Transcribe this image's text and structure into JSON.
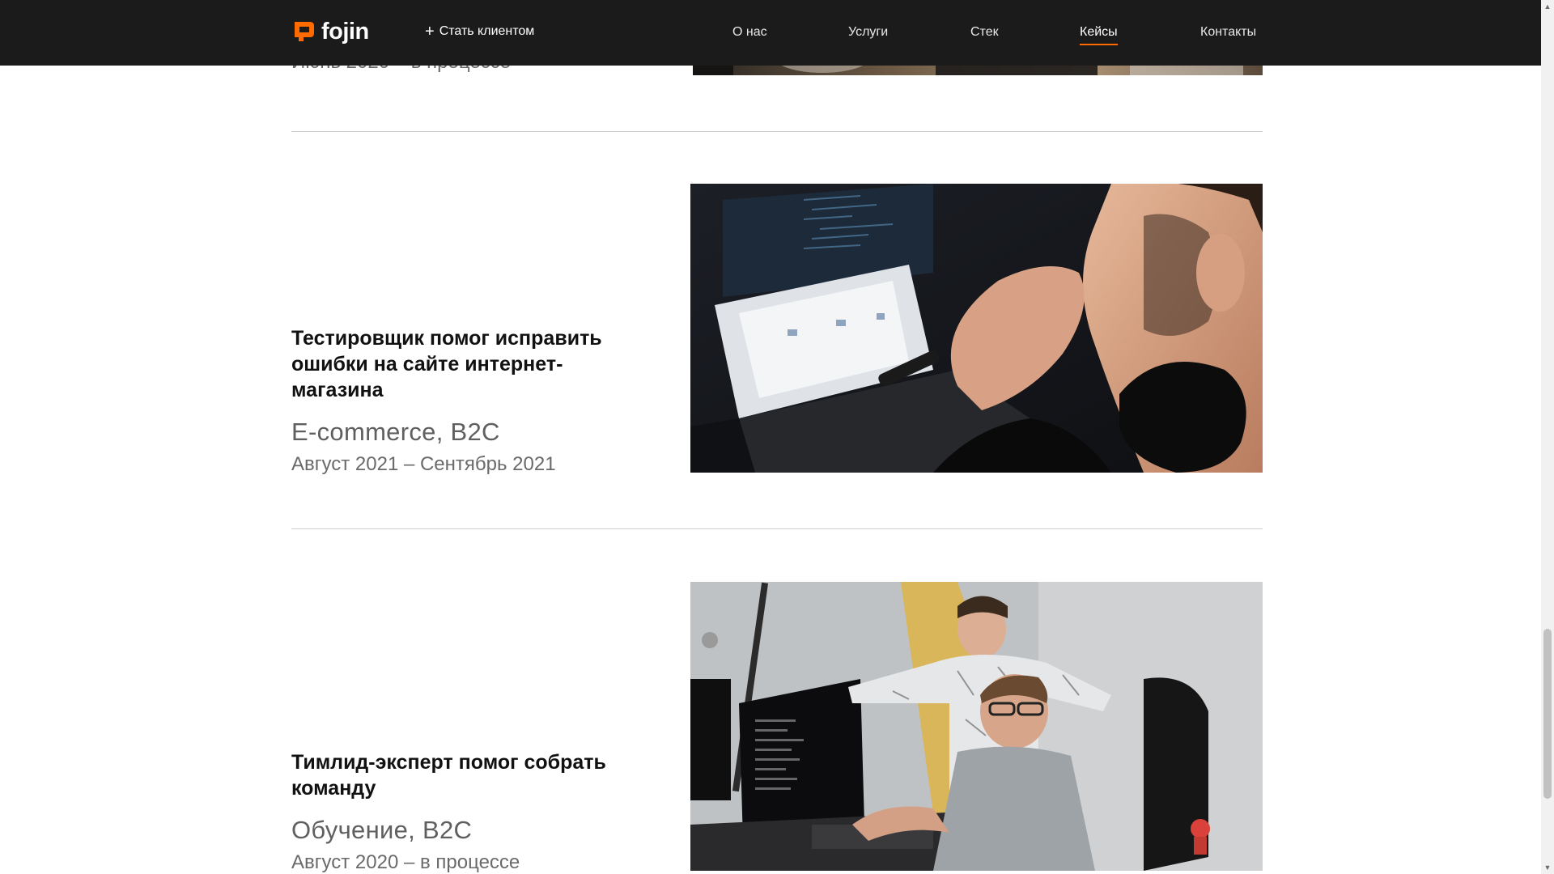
{
  "header": {
    "logo_text": "fojin",
    "cta_label": "Стать клиентом",
    "nav": [
      "О нас",
      "Услуги",
      "Стек",
      "Кейсы",
      "Контакты"
    ],
    "active_nav": "Кейсы",
    "accent": "#ff6b00",
    "background": "#1b1b1b"
  },
  "cases": [
    {
      "dates": "Июнь 2020 – в процессе"
    },
    {
      "title": "Тестировщик помог исправить ошибки на сайте интернет-магазина",
      "tags": "E-commerce, B2C",
      "dates": "Август 2021 – Сентябрь 2021"
    },
    {
      "title": "Тимлид-эксперт помог собрать команду",
      "tags": "Обучение, B2C",
      "dates": "Август 2020 – в процессе"
    }
  ]
}
